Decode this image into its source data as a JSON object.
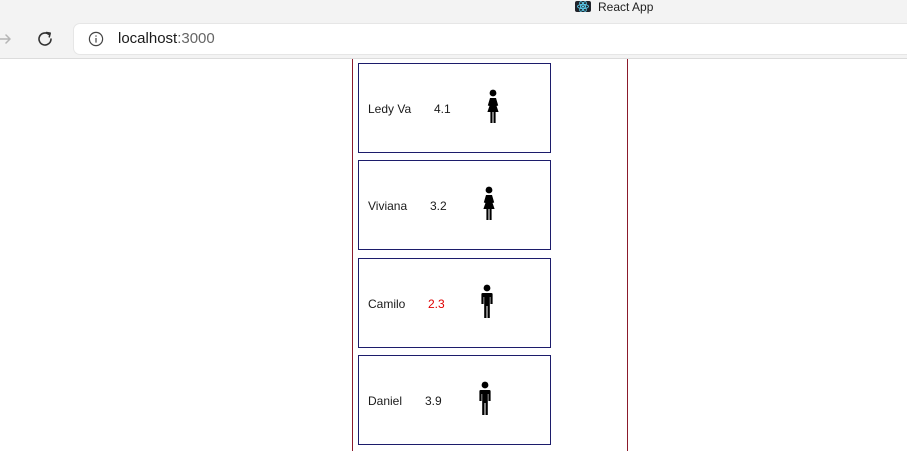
{
  "browser": {
    "tab": {
      "title": "React App",
      "icon": "react-logo-icon"
    },
    "address_bar": {
      "host": "localhost",
      "port": ":3000"
    }
  },
  "colors": {
    "column_border": "#8b1a2b",
    "card_border": "#1c1c6b",
    "low_score": "#e00000"
  },
  "people": [
    {
      "name": "Ledy Va",
      "score": "4.1",
      "gender": "female",
      "icon": "female-icon",
      "low": false
    },
    {
      "name": "Viviana",
      "score": "3.2",
      "gender": "female",
      "icon": "female-icon",
      "low": false
    },
    {
      "name": "Camilo",
      "score": "2.3",
      "gender": "male",
      "icon": "male-icon",
      "low": true
    },
    {
      "name": "Daniel",
      "score": "3.9",
      "gender": "male",
      "icon": "male-icon",
      "low": false
    }
  ]
}
